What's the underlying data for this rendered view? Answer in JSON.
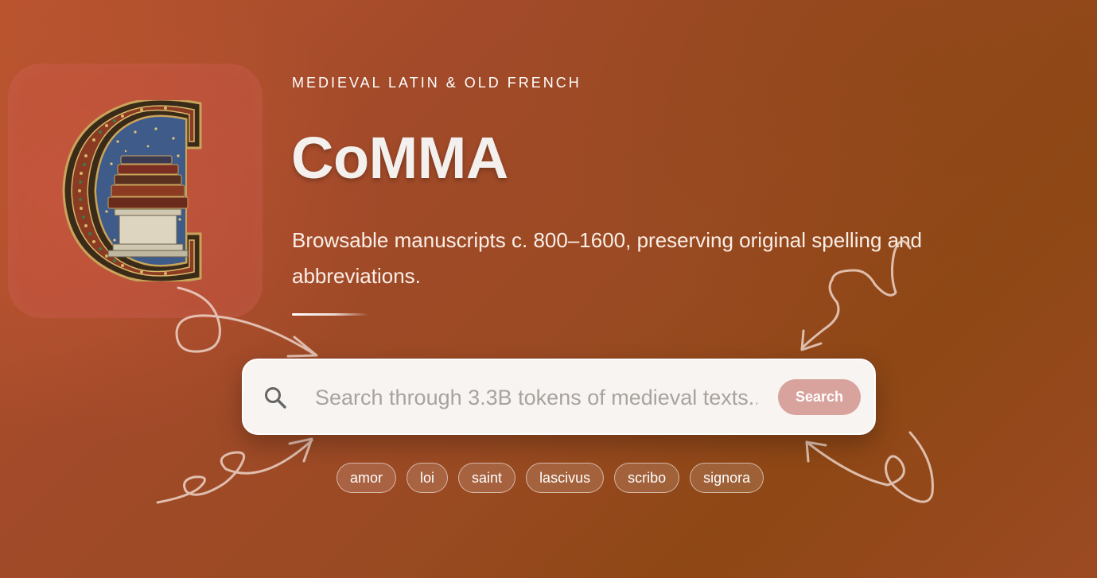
{
  "hero": {
    "eyebrow": "MEDIEVAL LATIN & OLD FRENCH",
    "title": "CoMMA",
    "tagline": "Browsable manuscripts c. 800–1600, preserving original spelling and abbreviations."
  },
  "logo": {
    "icon": "illuminated-letter-c-with-books-icon",
    "colors": {
      "tile": "#c8604f",
      "gold": "#c9a45a",
      "blue": "#3f5b8a",
      "red": "#9a3a26"
    }
  },
  "search": {
    "placeholder": "Search through 3.3B tokens of medieval texts...",
    "value": "",
    "button_label": "Search",
    "icon": "search-icon",
    "button_color": "#d9a39d"
  },
  "suggestions": [
    {
      "label": "amor"
    },
    {
      "label": "loi"
    },
    {
      "label": "saint"
    },
    {
      "label": "lascivus"
    },
    {
      "label": "scribo"
    },
    {
      "label": "signora"
    }
  ],
  "theme": {
    "background_accent": "#a24a2a",
    "text": "#ffffff"
  }
}
